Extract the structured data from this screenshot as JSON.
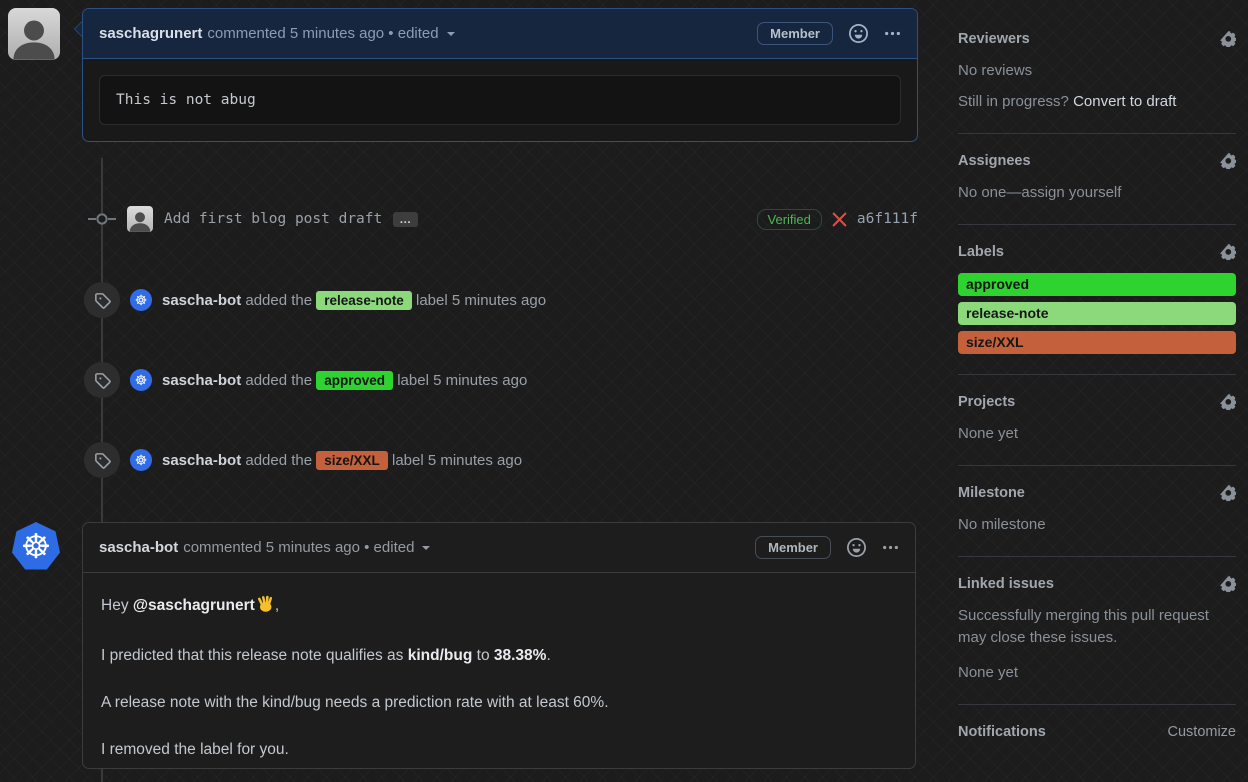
{
  "comment1": {
    "author": "saschagrunert",
    "meta": "commented 5 minutes ago • edited",
    "member_badge": "Member",
    "code": "This is not abug"
  },
  "commit": {
    "message": "Add first blog post draft",
    "expander": "…",
    "verified": "Verified",
    "sha": "a6f111f"
  },
  "events": [
    {
      "actor": "sascha-bot",
      "pre": "added the",
      "label": "release-note",
      "post": "label 5 minutes ago",
      "label_bg": "#8cd97c"
    },
    {
      "actor": "sascha-bot",
      "pre": "added the",
      "label": "approved",
      "post": "label 5 minutes ago",
      "label_bg": "#2fd32f"
    },
    {
      "actor": "sascha-bot",
      "pre": "added the",
      "label": "size/XXL",
      "post": "label 5 minutes ago",
      "label_bg": "#c4613c"
    }
  ],
  "comment2": {
    "author": "sascha-bot",
    "meta": "commented 5 minutes ago • edited",
    "member_badge": "Member",
    "p1_prefix": "Hey ",
    "p1_mention": "@saschagrunert",
    "p1_suffix": ",",
    "p2_prefix": "I predicted that this release note qualifies as ",
    "p2_bold1": "kind/bug",
    "p2_mid": " to ",
    "p2_bold2": "38.38%",
    "p2_suffix": ".",
    "p3": "A release note with the kind/bug needs a prediction rate with at least 60%.",
    "p4": "I removed the label for you."
  },
  "k8s_wheel_glyph": "☸",
  "sidebar": {
    "reviewers": {
      "title": "Reviewers",
      "empty": "No reviews",
      "progress_prefix": "Still in progress? ",
      "progress_link": "Convert to draft"
    },
    "assignees": {
      "title": "Assignees",
      "empty_prefix": "No one—",
      "empty_link": "assign yourself"
    },
    "labels": {
      "title": "Labels",
      "items": [
        {
          "name": "approved",
          "bg": "#2fd32f"
        },
        {
          "name": "release-note",
          "bg": "#8cd97c"
        },
        {
          "name": "size/XXL",
          "bg": "#c4613c"
        }
      ]
    },
    "projects": {
      "title": "Projects",
      "empty": "None yet"
    },
    "milestone": {
      "title": "Milestone",
      "empty": "No milestone"
    },
    "linked_issues": {
      "title": "Linked issues",
      "description": "Successfully merging this pull request may close these issues.",
      "empty": "None yet"
    },
    "notifications": {
      "title": "Notifications",
      "customize": "Customize"
    }
  }
}
